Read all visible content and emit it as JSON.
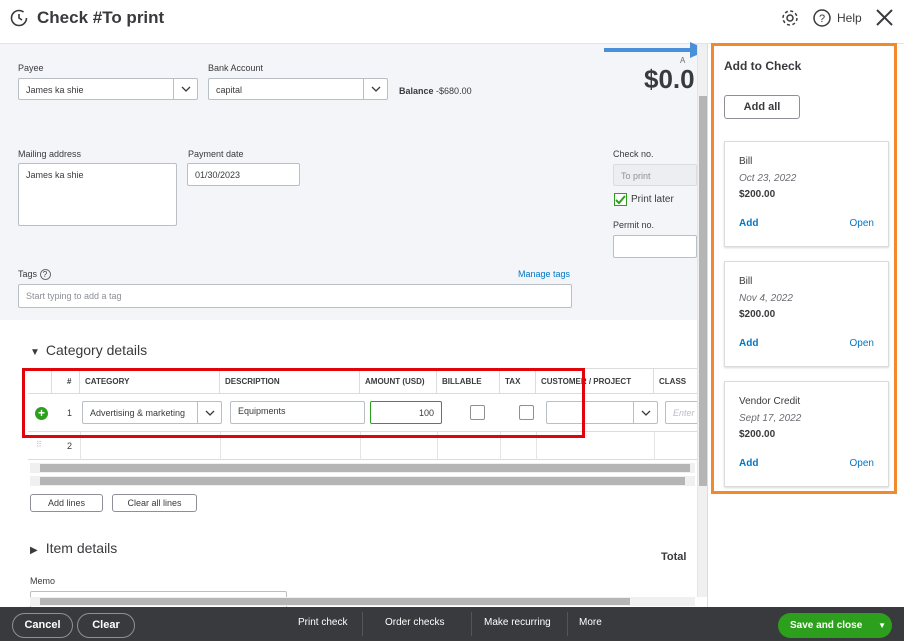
{
  "header": {
    "title": "Check #To print",
    "help": "Help"
  },
  "form": {
    "payee_label": "Payee",
    "payee_value": "James ka shie",
    "bank_label": "Bank Account",
    "bank_value": "capital",
    "balance_label": "Balance",
    "balance_value": "-$680.00",
    "amount_big": "$0.0",
    "amount_hint": "A",
    "mailing_label": "Mailing address",
    "mailing_value": "James ka shie",
    "date_label": "Payment date",
    "date_value": "01/30/2023",
    "checkno_label": "Check no.",
    "checkno_placeholder": "To print",
    "print_later": "Print later",
    "permit_label": "Permit no.",
    "tags_label": "Tags",
    "tags_placeholder": "Start typing to add a tag",
    "manage_tags": "Manage tags"
  },
  "category": {
    "title": "Category details",
    "columns": [
      "#",
      "CATEGORY",
      "DESCRIPTION",
      "AMOUNT (USD)",
      "BILLABLE",
      "TAX",
      "CUSTOMER / PROJECT",
      "CLASS"
    ],
    "row1": {
      "num": "1",
      "category": "Advertising & marketing",
      "description": "Equipments",
      "amount": "100",
      "class_placeholder": "Enter"
    },
    "row2": {
      "num": "2"
    },
    "add_lines": "Add lines",
    "clear_lines": "Clear all lines"
  },
  "item": {
    "title": "Item details"
  },
  "total_label": "Total",
  "memo_label": "Memo",
  "panel": {
    "title": "Add to Check",
    "add_all": "Add all",
    "cards": [
      {
        "type": "Bill",
        "date": "Oct 23, 2022",
        "amount": "$200.00",
        "add": "Add",
        "open": "Open"
      },
      {
        "type": "Bill",
        "date": "Nov 4, 2022",
        "amount": "$200.00",
        "add": "Add",
        "open": "Open"
      },
      {
        "type": "Vendor Credit",
        "date": "Sept 17, 2022",
        "amount": "$200.00",
        "add": "Add",
        "open": "Open"
      }
    ]
  },
  "footer": {
    "cancel": "Cancel",
    "clear": "Clear",
    "print_check": "Print check",
    "order_checks": "Order checks",
    "make_recurring": "Make recurring",
    "more": "More",
    "save_close": "Save and close"
  },
  "colors": {
    "accent_green": "#2ca01c",
    "link_blue": "#0077c5",
    "highlight_red": "#e0040b",
    "highlight_orange": "#f08a2c",
    "arrow_blue": "#4a90d9",
    "footer_bg": "#393a3d"
  }
}
